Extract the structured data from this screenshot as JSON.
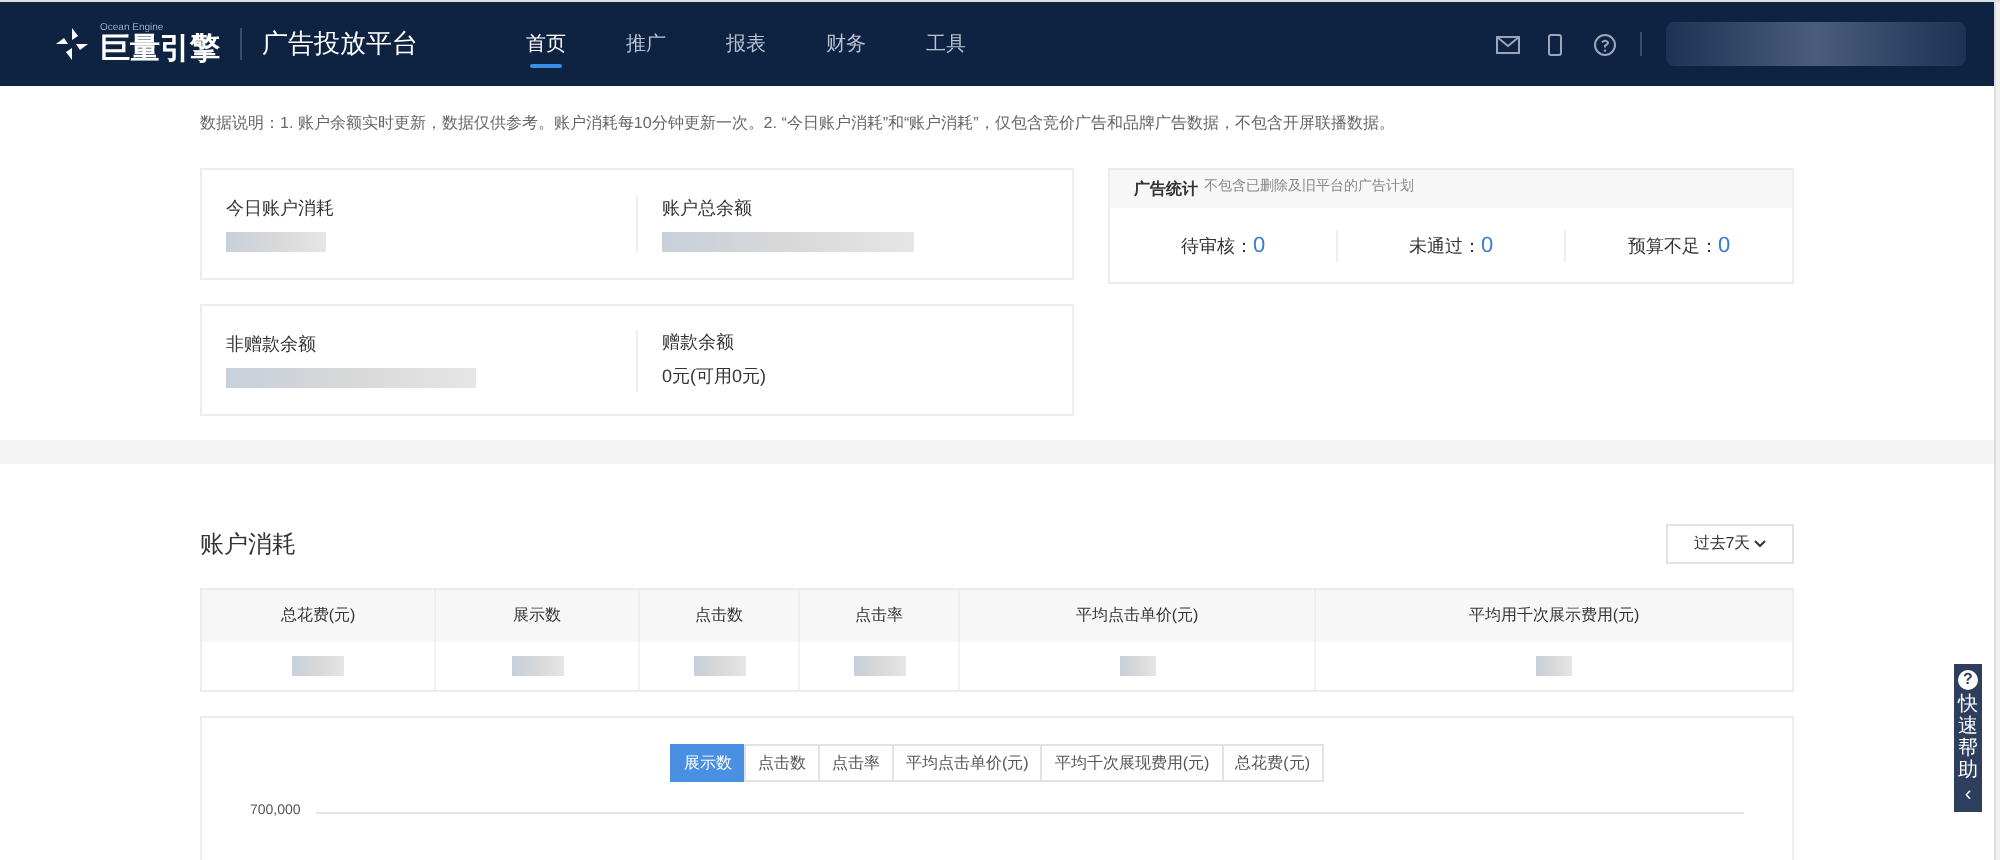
{
  "header": {
    "logo_small": "Ocean Engine",
    "logo": "巨量引擎",
    "platform": "广告投放平台",
    "nav": [
      {
        "label": "首页",
        "selected": true
      },
      {
        "label": "推广",
        "selected": false
      },
      {
        "label": "报表",
        "selected": false
      },
      {
        "label": "财务",
        "selected": false
      },
      {
        "label": "工具",
        "selected": false
      }
    ]
  },
  "notice": "数据说明：1. 账户余额实时更新，数据仅供参考。账户消耗每10分钟更新一次。2. “今日账户消耗”和“账户消耗”，仅包含竞价广告和品牌广告数据，不包含开屏联播数据。",
  "balance_cards": [
    [
      {
        "label": "今日账户消耗",
        "kind": "redacted"
      },
      {
        "label": "账户总余额",
        "kind": "redacted"
      }
    ],
    [
      {
        "label": "非赠款余额",
        "kind": "redacted"
      },
      {
        "label": "赠款余额",
        "kind": "text",
        "value": "0元(可用0元)"
      }
    ]
  ],
  "ad_stats": {
    "title": "广告统计",
    "note": "不包含已删除及旧平台的广告计划",
    "items": [
      {
        "label": "待审核：",
        "value": "0"
      },
      {
        "label": "未通过：",
        "value": "0"
      },
      {
        "label": "预算不足：",
        "value": "0"
      }
    ]
  },
  "spend": {
    "title": "账户消耗",
    "range": "过去7天",
    "columns": [
      "总花费(元)",
      "展示数",
      "点击数",
      "点击率",
      "平均点击单价(元)",
      "平均用千次展示费用(元)"
    ],
    "chart_tabs": [
      {
        "label": "展示数",
        "selected": true
      },
      {
        "label": "点击数",
        "selected": false
      },
      {
        "label": "点击率",
        "selected": false
      },
      {
        "label": "平均点击单价(元)",
        "selected": false
      },
      {
        "label": "平均千次展现费用(元)",
        "selected": false
      },
      {
        "label": "总花费(元)",
        "selected": false
      }
    ],
    "y_tick_label": "700,000"
  },
  "help_tab": {
    "icon": "?",
    "label": "快速帮助",
    "arrow": "‹"
  }
}
